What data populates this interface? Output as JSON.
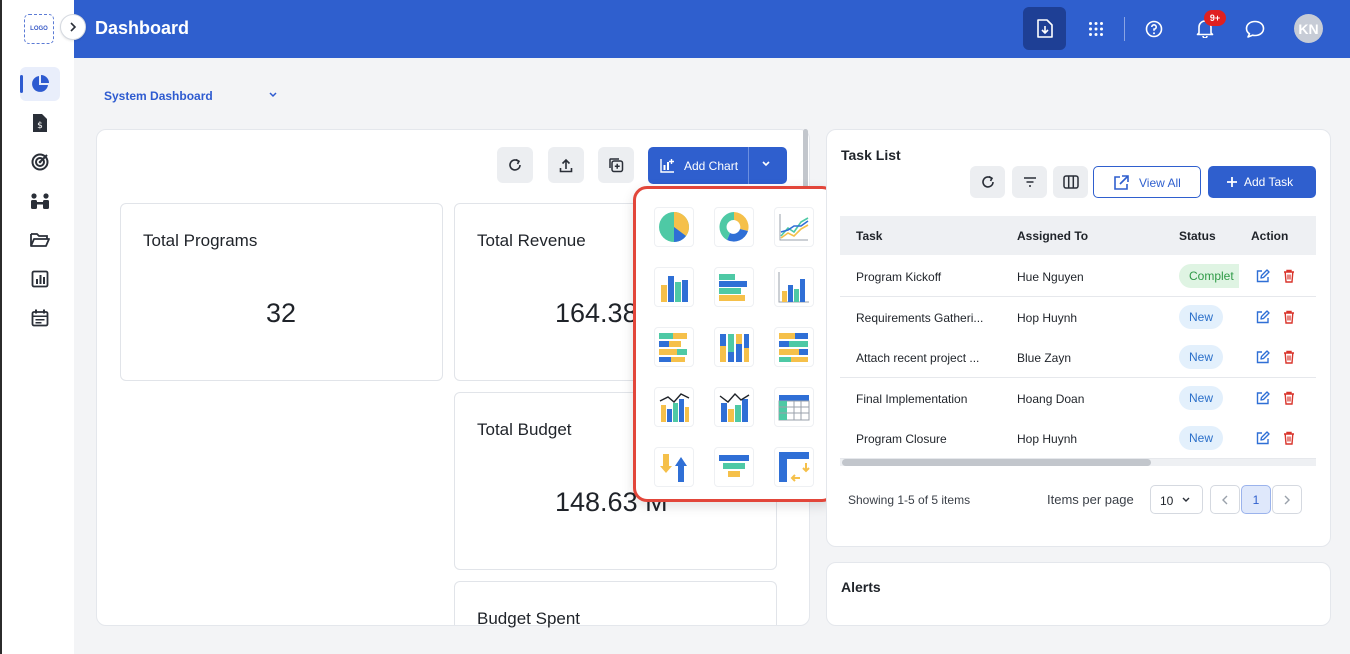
{
  "sidebar": {
    "logo_text": "LOGO",
    "items": [
      {
        "icon": "pie-chart-icon",
        "active": true
      },
      {
        "icon": "invoice-dollar-icon"
      },
      {
        "icon": "target-icon"
      },
      {
        "icon": "team-icon"
      },
      {
        "icon": "folder-icon"
      },
      {
        "icon": "report-icon"
      },
      {
        "icon": "calendar-icon"
      }
    ]
  },
  "header": {
    "title": "Dashboard",
    "notification_count": "9+",
    "avatar_initials": "KN"
  },
  "dashboard_select": {
    "value": "System Dashboard"
  },
  "toolbar": {
    "add_chart_label": "Add Chart"
  },
  "cards": {
    "total_programs": {
      "title": "Total Programs",
      "value": "32"
    },
    "total_revenue": {
      "title": "Total Revenue",
      "value": "164.38"
    },
    "total_budget": {
      "title": "Total Budget",
      "value": "148.63 M"
    },
    "budget_spent": {
      "title": "Budget Spent"
    }
  },
  "chart_picker": {
    "options": [
      "pie-chart-icon",
      "donut-chart-icon",
      "line-chart-icon",
      "column-chart-icon",
      "bar-chart-icon",
      "grouped-column-chart-icon",
      "stacked-bar-chart-icon",
      "stacked-column-chart-icon",
      "stacked-bar-100-chart-icon",
      "combo-chart-icon",
      "combo-line-chart-icon",
      "table-chart-icon",
      "waterfall-chart-icon",
      "funnel-chart-icon",
      "pivot-chart-icon"
    ]
  },
  "task_list": {
    "title": "Task List",
    "view_all_label": "View All",
    "add_task_label": "Add Task",
    "columns": [
      "Task",
      "Assigned To",
      "Status",
      "Action"
    ],
    "rows": [
      {
        "task": "Program Kickoff",
        "assigned": "Hue Nguyen",
        "status": "Complet",
        "status_type": "done"
      },
      {
        "task": "Requirements Gatheri...",
        "assigned": "Hop Huynh",
        "status": "New",
        "status_type": "new"
      },
      {
        "task": "Attach recent project ...",
        "assigned": "Blue Zayn",
        "status": "New",
        "status_type": "new"
      },
      {
        "task": "Final Implementation",
        "assigned": "Hoang Doan",
        "status": "New",
        "status_type": "new"
      },
      {
        "task": "Program Closure",
        "assigned": "Hop Huynh",
        "status": "New",
        "status_type": "new"
      }
    ],
    "showing_text": "Showing 1-5 of 5 items",
    "items_per_page_label": "Items per page",
    "items_per_page_value": "10",
    "current_page": "1"
  },
  "alerts": {
    "title": "Alerts"
  },
  "colors": {
    "primary": "#2f5fce",
    "header_dark": "#1e3f95",
    "picker_border": "#e2463a",
    "status_new_bg": "#e3f0fc",
    "status_done_bg": "#dff4e3"
  }
}
